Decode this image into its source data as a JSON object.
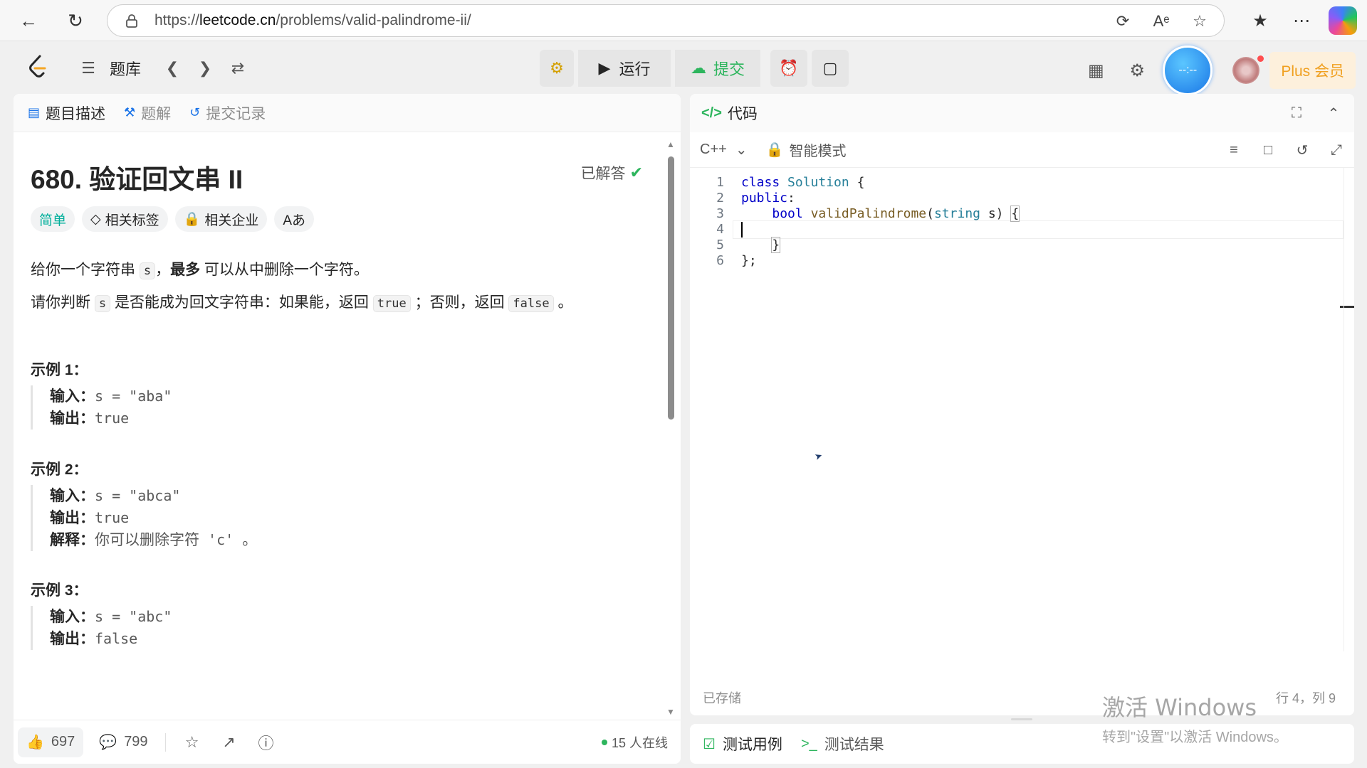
{
  "browser": {
    "url_prefix": "https://",
    "url_domain": "leetcode.cn",
    "url_path": "/problems/valid-palindrome-ii/"
  },
  "toolbar": {
    "problem_bank_label": "题库",
    "run_label": "运行",
    "submit_label": "提交",
    "timer_text": "--:--",
    "plus_label": "Plus 会员"
  },
  "left_tabs": [
    {
      "label": "题目描述"
    },
    {
      "label": "题解"
    },
    {
      "label": "提交记录"
    }
  ],
  "problem": {
    "title": "680. 验证回文串 II",
    "status": "已解答",
    "tags": [
      "简单",
      "相关标签",
      "相关企业",
      "Aあ"
    ],
    "desc1_a": "给你一个字符串",
    "desc1_code": "s",
    "desc1_b": "，",
    "desc1_bold": "最多",
    "desc1_c": " 可以从中删除一个字符。",
    "desc2_a": "请你判断",
    "desc2_code1": "s",
    "desc2_b": "是否能成为回文字符串：如果能，返回",
    "desc2_code2": "true",
    "desc2_c": "；否则，返回",
    "desc2_code3": "false",
    "desc2_d": "。",
    "examples": [
      {
        "title": "示例 1：",
        "input_k": "输入：",
        "input_v": "s = \"aba\"",
        "output_k": "输出：",
        "output_v": "true"
      },
      {
        "title": "示例 2：",
        "input_k": "输入：",
        "input_v": "s = \"abca\"",
        "output_k": "输出：",
        "output_v": "true",
        "explain_k": "解释：",
        "explain_v1": "你可以删除字符",
        "explain_code": " 'c' ",
        "explain_v2": "。"
      },
      {
        "title": "示例 3：",
        "input_k": "输入：",
        "input_v": "s = \"abc\"",
        "output_k": "输出：",
        "output_v": "false"
      }
    ]
  },
  "bottom": {
    "likes": "697",
    "comments": "799",
    "online": "15 人在线"
  },
  "code_panel": {
    "title": "代码",
    "language": "C++",
    "mode": "智能模式",
    "lines": [
      "1",
      "2",
      "3",
      "4",
      "5",
      "6"
    ],
    "stored": "已存储",
    "position": "行 4，列 9"
  },
  "test_bar": {
    "testcase_label": "测试用例",
    "result_label": "测试结果"
  },
  "watermark": {
    "line1": "激活 Windows",
    "line2": "转到\"设置\"以激活 Windows。"
  },
  "colors": {
    "accent_green": "#2db55d",
    "easy_teal": "#00af9b",
    "plus_orange": "#f0a020",
    "link_blue": "#1a73e8"
  }
}
